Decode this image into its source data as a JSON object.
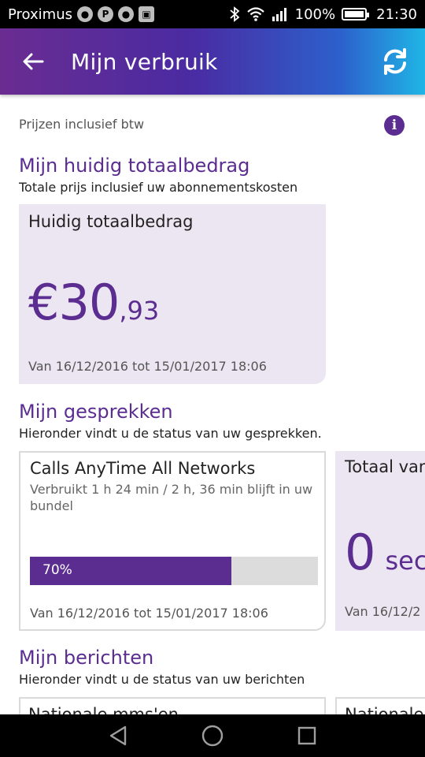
{
  "status_bar": {
    "carrier": "Proximus",
    "battery": "100%",
    "time": "21:30",
    "notification_icons": [
      "person-icon",
      "pinterest-icon",
      "person-icon",
      "photo-icon"
    ],
    "system_icons": [
      "bluetooth-icon",
      "wifi-icon",
      "signal-icon",
      "battery-icon"
    ]
  },
  "app_bar": {
    "title": "Mijn verbruik",
    "gradient": [
      "#6a2c91",
      "#1fb6e6"
    ]
  },
  "header": {
    "vat_note": "Prijzen inclusief btw"
  },
  "total_section": {
    "title": "Mijn huidig totaalbedrag",
    "subtitle": "Totale prijs inclusief uw abonnementskosten",
    "card": {
      "heading": "Huidig totaalbedrag",
      "amount_main": "€30",
      "amount_cents": ",93",
      "period": "Van 16/12/2016 tot 15/01/2017 18:06"
    }
  },
  "calls_section": {
    "title": "Mijn gesprekken",
    "subtitle": "Hieronder vindt u de status van uw gesprekken.",
    "cards": [
      {
        "heading": "Calls AnyTime All Networks",
        "usage": "Verbruikt 1 h 24 min / 2 h, 36 min blijft in uw bundel",
        "progress_percent": 70,
        "progress_label": "70%",
        "period": "Van 16/12/2016 tot 15/01/2017 18:06"
      },
      {
        "heading": "Totaal van",
        "value": "0",
        "unit": "sec",
        "period": "Van 16/12/2"
      }
    ]
  },
  "messages_section": {
    "title": "Mijn berichten",
    "subtitle": "Hieronder vindt u de status van uw berichten",
    "cards": [
      {
        "heading": "Nationale mms'en"
      },
      {
        "heading": "Nationale"
      }
    ]
  },
  "colors": {
    "accent": "#5c2d91",
    "card_bg": "#ebe6f2"
  }
}
